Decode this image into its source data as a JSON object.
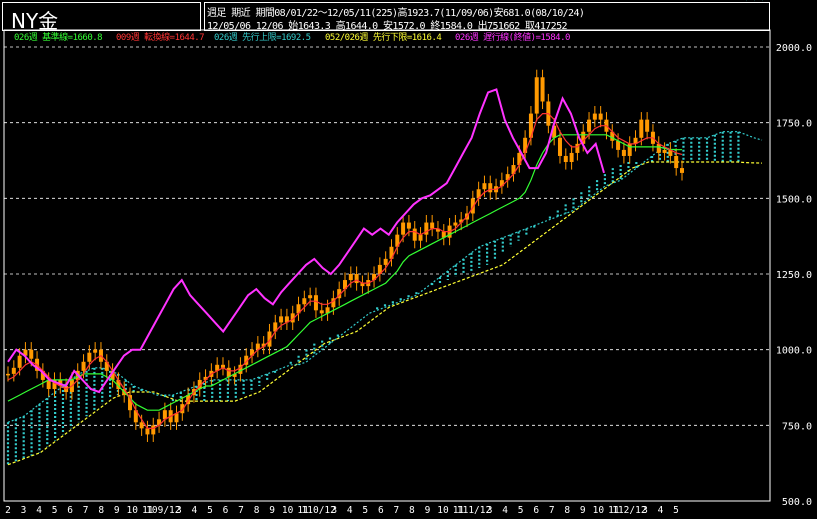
{
  "header": {
    "title": "NY金",
    "info_line1": "週足 期近 期間08/01/22〜12/05/11(225)高1923.7(11/09/06)安681.0(08/10/24)",
    "info_line2": "12/05/06 12/06 始1643.3 高1644.0 安1572.0 終1584.0 出751662 取417252"
  },
  "legend": [
    {
      "text": "026週 基準線=1660.8",
      "color": "#33ff33"
    },
    {
      "text": "009週 転換線=1644.7",
      "color": "#ff3333"
    },
    {
      "text": "026週 先行上限=1692.5",
      "color": "#33cccc"
    },
    {
      "text": "052/026週 先行下限=1616.4",
      "color": "#ffff33"
    },
    {
      "text": "026週 遅行線(終値)=1584.0",
      "color": "#ff33ff"
    }
  ],
  "colors": {
    "candle": "#ff9900",
    "kijun": "#33ff33",
    "tenkan": "#ff3333",
    "cloud": "#33cccc",
    "span_b": "#ffff33",
    "chikou": "#ff33ff",
    "grid": "#ffffff"
  },
  "chart_data": {
    "type": "line",
    "ylim": [
      500,
      2000
    ],
    "yticks": [
      "2000.0",
      "1750.0",
      "1500.0",
      "1250.0",
      "1000.0",
      "750.0",
      "500.0"
    ],
    "xticks": [
      "2",
      "3",
      "4",
      "5",
      "6",
      "7",
      "8",
      "9",
      "10",
      "11",
      "109/12",
      "3",
      "4",
      "5",
      "6",
      "7",
      "8",
      "9",
      "10",
      "11",
      "110/12",
      "3",
      "4",
      "5",
      "6",
      "7",
      "8",
      "9",
      "10",
      "11",
      "111/12",
      "3",
      "4",
      "5",
      "6",
      "7",
      "8",
      "9",
      "10",
      "11",
      "112/12",
      "3",
      "4",
      "5"
    ],
    "series": [
      {
        "key": "close",
        "color": "#ff9900",
        "values": [
          920,
          940,
          980,
          1000,
          970,
          930,
          900,
          870,
          900,
          880,
          860,
          900,
          930,
          960,
          990,
          1000,
          960,
          930,
          900,
          870,
          850,
          800,
          760,
          740,
          720,
          750,
          770,
          800,
          760,
          790,
          820,
          850,
          870,
          900,
          910,
          930,
          950,
          940,
          910,
          920,
          950,
          980,
          1000,
          1020,
          1010,
          1060,
          1090,
          1110,
          1090,
          1120,
          1150,
          1170,
          1180,
          1130,
          1120,
          1140,
          1170,
          1200,
          1230,
          1250,
          1220,
          1210,
          1230,
          1250,
          1280,
          1300,
          1340,
          1380,
          1420,
          1400,
          1360,
          1380,
          1420,
          1400,
          1390,
          1370,
          1410,
          1420,
          1430,
          1450,
          1500,
          1530,
          1550,
          1520,
          1540,
          1560,
          1580,
          1610,
          1650,
          1700,
          1780,
          1900,
          1820,
          1740,
          1700,
          1640,
          1620,
          1650,
          1680,
          1720,
          1760,
          1780,
          1760,
          1720,
          1690,
          1660,
          1640,
          1680,
          1700,
          1760,
          1720,
          1680,
          1650,
          1660,
          1640,
          1600,
          1584
        ]
      },
      {
        "key": "tenkan",
        "color": "#ff3333",
        "values": [
          900,
          910,
          930,
          950,
          960,
          950,
          930,
          910,
          890,
          880,
          870,
          880,
          900,
          920,
          950,
          970,
          980,
          960,
          930,
          900,
          870,
          840,
          800,
          770,
          740,
          740,
          750,
          770,
          780,
          790,
          800,
          830,
          860,
          880,
          900,
          920,
          930,
          940,
          930,
          930,
          940,
          960,
          980,
          1000,
          1010,
          1030,
          1060,
          1080,
          1090,
          1100,
          1120,
          1140,
          1160,
          1160,
          1150,
          1150,
          1160,
          1180,
          1200,
          1220,
          1230,
          1220,
          1220,
          1230,
          1250,
          1270,
          1300,
          1340,
          1370,
          1390,
          1390,
          1380,
          1390,
          1400,
          1400,
          1390,
          1390,
          1400,
          1420,
          1440,
          1470,
          1500,
          1520,
          1530,
          1530,
          1540,
          1560,
          1580,
          1610,
          1650,
          1700,
          1760,
          1780,
          1780,
          1760,
          1720,
          1690,
          1670,
          1670,
          1690,
          1710,
          1730,
          1740,
          1740,
          1720,
          1700,
          1690,
          1680,
          1680,
          1690,
          1700,
          1700,
          1680,
          1670,
          1660,
          1650,
          1645
        ]
      },
      {
        "key": "kijun",
        "color": "#33ff33",
        "values": [
          830,
          840,
          850,
          860,
          870,
          880,
          890,
          900,
          900,
          900,
          900,
          900,
          910,
          920,
          920,
          920,
          920,
          910,
          900,
          880,
          860,
          840,
          820,
          810,
          800,
          800,
          800,
          810,
          820,
          830,
          840,
          850,
          860,
          870,
          880,
          880,
          890,
          900,
          910,
          920,
          930,
          940,
          950,
          960,
          970,
          980,
          990,
          1000,
          1010,
          1030,
          1050,
          1070,
          1090,
          1100,
          1110,
          1120,
          1130,
          1140,
          1150,
          1160,
          1170,
          1180,
          1190,
          1200,
          1210,
          1220,
          1240,
          1260,
          1290,
          1310,
          1320,
          1330,
          1340,
          1350,
          1360,
          1370,
          1380,
          1390,
          1400,
          1410,
          1420,
          1430,
          1440,
          1450,
          1460,
          1470,
          1480,
          1490,
          1500,
          1520,
          1560,
          1610,
          1650,
          1680,
          1700,
          1710,
          1710,
          1710,
          1710,
          1710,
          1710,
          1710,
          1710,
          1710,
          1700,
          1690,
          1680,
          1670,
          1670,
          1670,
          1670,
          1670,
          1670,
          1665,
          1662,
          1661,
          1660.8
        ]
      },
      {
        "key": "chikou",
        "color": "#ff33ff",
        "values": [
          960,
          1000,
          980,
          950,
          930,
          900,
          890,
          880,
          930,
          900,
          870,
          860,
          900,
          940,
          980,
          1000,
          1000,
          1050,
          1100,
          1150,
          1200,
          1230,
          1180,
          1150,
          1120,
          1090,
          1060,
          1100,
          1140,
          1180,
          1200,
          1170,
          1150,
          1190,
          1220,
          1250,
          1280,
          1300,
          1270,
          1250,
          1280,
          1320,
          1360,
          1400,
          1380,
          1400,
          1380,
          1420,
          1450,
          1480,
          1500,
          1510,
          1530,
          1550,
          1600,
          1650,
          1700,
          1780,
          1850,
          1860,
          1760,
          1700,
          1650,
          1600,
          1600,
          1650,
          1750,
          1830,
          1780,
          1700,
          1650,
          1680,
          1584
        ]
      },
      {
        "key": "span_a",
        "color": "#33cccc",
        "values": [
          760,
          770,
          780,
          800,
          820,
          840,
          860,
          880,
          900,
          920,
          930,
          940,
          940,
          930,
          920,
          900,
          880,
          870,
          860,
          850,
          850,
          850,
          860,
          870,
          880,
          890,
          900,
          900,
          900,
          900,
          900,
          900,
          910,
          920,
          930,
          940,
          950,
          950,
          960,
          980,
          1000,
          1020,
          1040,
          1060,
          1080,
          1100,
          1120,
          1130,
          1140,
          1150,
          1160,
          1170,
          1180,
          1200,
          1220,
          1240,
          1260,
          1280,
          1300,
          1320,
          1340,
          1350,
          1360,
          1370,
          1380,
          1390,
          1400,
          1410,
          1420,
          1430,
          1440,
          1450,
          1460,
          1480,
          1500,
          1520,
          1540,
          1550,
          1560,
          1580,
          1600,
          1620,
          1640,
          1660,
          1680,
          1690,
          1700,
          1700,
          1700,
          1700,
          1710,
          1720,
          1720,
          1720,
          1710,
          1700,
          1692.5
        ]
      },
      {
        "key": "span_b",
        "color": "#ffff33",
        "values": [
          620,
          630,
          640,
          650,
          660,
          680,
          700,
          720,
          740,
          760,
          780,
          800,
          820,
          840,
          850,
          860,
          860,
          860,
          860,
          850,
          840,
          830,
          830,
          830,
          830,
          830,
          830,
          830,
          830,
          840,
          850,
          860,
          880,
          900,
          920,
          940,
          960,
          980,
          1000,
          1020,
          1030,
          1040,
          1050,
          1060,
          1080,
          1100,
          1120,
          1140,
          1150,
          1160,
          1170,
          1180,
          1190,
          1200,
          1210,
          1220,
          1230,
          1240,
          1250,
          1260,
          1270,
          1280,
          1300,
          1320,
          1340,
          1360,
          1380,
          1400,
          1420,
          1440,
          1460,
          1480,
          1500,
          1520,
          1540,
          1560,
          1580,
          1600,
          1610,
          1620,
          1620,
          1620,
          1620,
          1620,
          1620,
          1620,
          1620,
          1620,
          1620,
          1620,
          1620,
          1618,
          1617,
          1616.4
        ]
      }
    ]
  }
}
